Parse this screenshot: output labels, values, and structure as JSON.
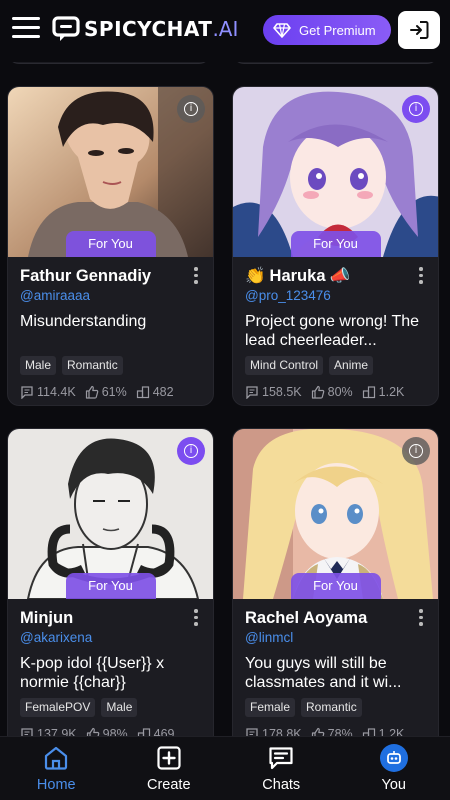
{
  "header": {
    "logo_main": "SPICYCHAT",
    "logo_suffix": ".AI",
    "premium_label": "Get Premium"
  },
  "cards": [
    {
      "name": "Fathur Gennadiy",
      "emoji_prefix": "",
      "emoji_suffix": "",
      "handle": "@amiraaaa",
      "description": "Misunderstanding",
      "badge": "For You",
      "tags": [
        "Male",
        "Romantic"
      ],
      "messages": "114.4K",
      "rating": "61%",
      "bots": "482"
    },
    {
      "name": "Haruka",
      "emoji_prefix": "👏",
      "emoji_suffix": "📣",
      "handle": "@pro_123476",
      "description": "Project gone wrong! The lead cheerleader...",
      "badge": "For You",
      "tags": [
        "Mind Control",
        "Anime"
      ],
      "messages": "158.5K",
      "rating": "80%",
      "bots": "1.2K"
    },
    {
      "name": "Minjun",
      "emoji_prefix": "",
      "emoji_suffix": "",
      "handle": "@akarixena",
      "description": "K-pop idol {{User}} x normie {{char}}",
      "badge": "For You",
      "tags": [
        "FemalePOV",
        "Male"
      ],
      "messages": "137.9K",
      "rating": "98%",
      "bots": "469"
    },
    {
      "name": "Rachel Aoyama",
      "emoji_prefix": "",
      "emoji_suffix": "",
      "handle": "@linmcl",
      "description": "You guys will still be classmates and it wi...",
      "badge": "For You",
      "tags": [
        "Female",
        "Romantic"
      ],
      "messages": "178.8K",
      "rating": "78%",
      "bots": "1.2K"
    }
  ],
  "nav": [
    {
      "label": "Home",
      "icon": "home-icon",
      "active": true
    },
    {
      "label": "Create",
      "icon": "plus-square-icon",
      "active": false
    },
    {
      "label": "Chats",
      "icon": "chat-bubble-icon",
      "active": false
    },
    {
      "label": "You",
      "icon": "bot-avatar-icon",
      "active": false
    }
  ],
  "colors": {
    "background": "#0b0b0f",
    "card": "#1c1c22",
    "accent_purple": "#7c4df0",
    "handle_blue": "#4a8eea"
  }
}
